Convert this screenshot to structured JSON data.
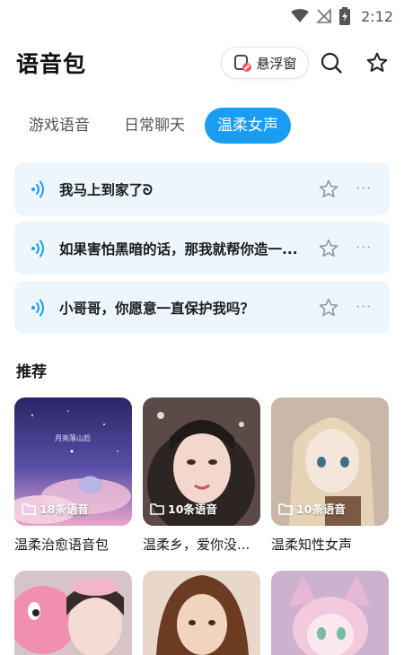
{
  "status_bar": {
    "time": "2:12"
  },
  "header": {
    "title": "语音包",
    "float_window_label": "悬浮窗"
  },
  "tabs": [
    {
      "label": "游戏语音",
      "active": false
    },
    {
      "label": "日常聊天",
      "active": false
    },
    {
      "label": "温柔女声",
      "active": true
    }
  ],
  "voice_items": [
    {
      "text": "我马上到家了ᘐ"
    },
    {
      "text": "如果害怕黑暗的话，那我就帮你造一..."
    },
    {
      "text": "小哥哥，你愿意一直保护我吗？"
    }
  ],
  "recommend": {
    "title": "推荐",
    "cards": [
      {
        "count": "18条语音",
        "name": "温柔治愈语音包",
        "thumb_text": "月亮落山后"
      },
      {
        "count": "10条语音",
        "name": "温柔乡，爱你没..."
      },
      {
        "count": "10条语音",
        "name": "温柔知性女声"
      }
    ]
  },
  "colors": {
    "accent": "#1a9cf2",
    "item_bg": "#eef6fd"
  },
  "icons": {
    "search": "search-icon",
    "star": "star-icon",
    "voice": "sound-wave-icon",
    "folder": "folder-icon"
  }
}
